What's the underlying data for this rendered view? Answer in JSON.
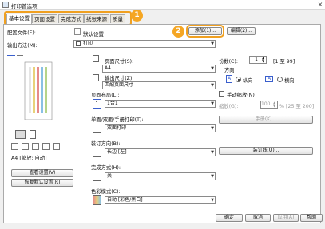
{
  "window": {
    "title": "打印首选项",
    "close": "×"
  },
  "tabs": [
    "基本设置",
    "页面设置",
    "完成方式",
    "纸张来源",
    "质量"
  ],
  "badges": [
    "1",
    "2"
  ],
  "profile": {
    "label": "配置文件(F):",
    "value": "默认设置",
    "add_button": "添加(1)...",
    "edit_button": "编辑(2)..."
  },
  "output_method": {
    "label": "输出方法(M):",
    "value": "打印"
  },
  "page_size": {
    "label": "页面尺寸(S):",
    "value": "A4"
  },
  "output_size": {
    "label": "输出尺寸(Z):",
    "value": "匹配页面尺寸"
  },
  "copies": {
    "label": "份数(C):",
    "value": "1",
    "range": "[1 至 99]"
  },
  "orientation": {
    "label": "方向",
    "portrait": "纵向",
    "landscape": "横向",
    "selected": "portrait"
  },
  "page_layout": {
    "label": "页面布局(L):",
    "value": "1合1"
  },
  "manual_scaling": {
    "label": "手动缩放(N)",
    "scale_label": "缩放(G):",
    "scale_value": "100",
    "scale_range": "% [25 至 200]"
  },
  "paper_button": "手册(K)...",
  "duplex": {
    "label": "单面/双面/手册打印(T):",
    "value": "双面打印"
  },
  "binding": {
    "label": "装订方向(B):",
    "value": "长边 [左]",
    "button": "装订线(U)..."
  },
  "finishing": {
    "label": "完成方式(H):",
    "value": "关"
  },
  "color_mode": {
    "label": "色彩模式(C):",
    "value": "自动 [彩色/黑白]"
  },
  "preview": {
    "caption": "A4 [缩放: 自动]",
    "view_settings": "查看设置(V)",
    "restore_defaults": "恢复默认设置(R)"
  },
  "footer": {
    "ok": "确定",
    "cancel": "取消",
    "apply": "应用(A)",
    "help": "帮助"
  }
}
